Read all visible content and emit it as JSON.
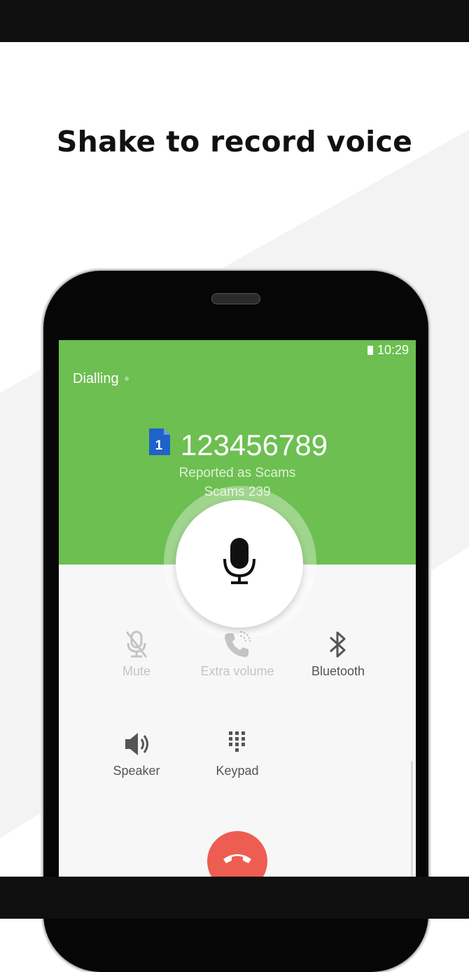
{
  "headline": "Shake to record voice",
  "status_bar": {
    "time": "10:29"
  },
  "call": {
    "state": "Dialling",
    "sim_slot": "1",
    "number": "123456789",
    "report_label": "Reported as Scams",
    "scams_count": "Scams 239"
  },
  "controls": [
    {
      "label": "Mute",
      "icon": "mute-icon",
      "enabled": false
    },
    {
      "label": "Extra volume",
      "icon": "extra-volume-icon",
      "enabled": false
    },
    {
      "label": "Bluetooth",
      "icon": "bluetooth-icon",
      "enabled": true
    },
    {
      "label": "Speaker",
      "icon": "speaker-icon",
      "enabled": true
    },
    {
      "label": "Keypad",
      "icon": "keypad-icon",
      "enabled": true
    }
  ],
  "colors": {
    "call_header": "#6cbf50",
    "end_call": "#ee5d52",
    "dark_bar": "#0f0f0f"
  }
}
